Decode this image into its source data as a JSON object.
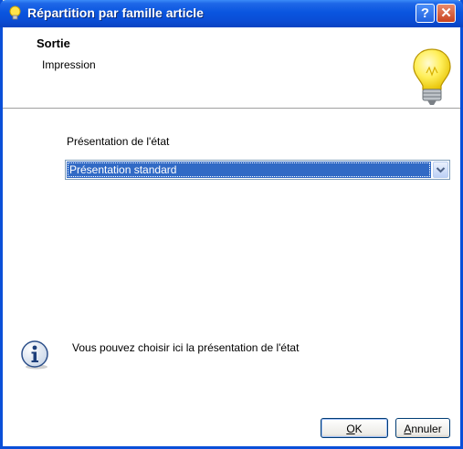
{
  "window": {
    "title": "Répartition par famille article",
    "help_glyph": "?",
    "close_glyph": "✕"
  },
  "header": {
    "title": "Sortie",
    "subtitle": "Impression",
    "icon": "lightbulb-icon"
  },
  "form": {
    "field_label": "Présentation de l'état",
    "select_value": "Présentation standard"
  },
  "info": {
    "icon": "info-icon",
    "text": "Vous pouvez choisir ici la présentation de l'état"
  },
  "buttons": {
    "ok_mnemonic": "O",
    "ok_rest": "K",
    "cancel_mnemonic": "A",
    "cancel_rest": "nnuler"
  },
  "colors": {
    "titlebar": "#0a4fd8",
    "selection": "#316ac5",
    "dialog_background": "#ffffff"
  }
}
